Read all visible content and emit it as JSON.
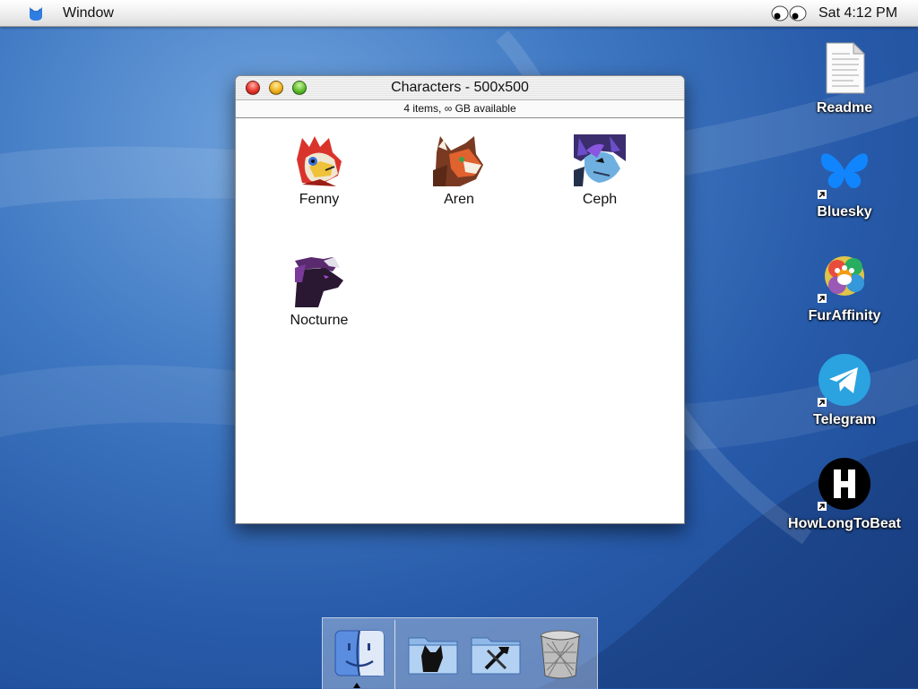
{
  "menubar": {
    "app_icon": "blue-cat-icon",
    "menu_items": [
      "Window"
    ],
    "extras_icon": "eyes-icon",
    "clock": "Sat 4:12 PM"
  },
  "window": {
    "title": "Characters - 500x500",
    "status": "4 items, ∞ GB available",
    "files": [
      {
        "name": "Fenny",
        "icon": "fenny-avatar-icon",
        "color": "#d9342b"
      },
      {
        "name": "Aren",
        "icon": "aren-avatar-icon",
        "color": "#e0622f"
      },
      {
        "name": "Ceph",
        "icon": "ceph-avatar-icon",
        "color": "#6a4fc9"
      },
      {
        "name": "Nocturne",
        "icon": "nocturne-avatar-icon",
        "color": "#2a1832"
      }
    ]
  },
  "desktop": {
    "icons": [
      {
        "label": "Readme",
        "icon": "document-icon"
      },
      {
        "label": "Bluesky",
        "icon": "butterfly-icon",
        "alias": true
      },
      {
        "label": "FurAffinity",
        "icon": "paw-icon",
        "alias": true
      },
      {
        "label": "Telegram",
        "icon": "paper-plane-icon",
        "alias": true
      },
      {
        "label": "HowLongToBeat",
        "icon": "hltb-icon",
        "alias": true
      }
    ]
  },
  "dock": {
    "items": [
      {
        "name": "Finder",
        "icon": "finder-icon",
        "running": true
      },
      {
        "name": "Folder",
        "icon": "fox-folder-icon"
      },
      {
        "name": "Folder",
        "icon": "tools-folder-icon"
      },
      {
        "name": "Trash",
        "icon": "trash-icon"
      }
    ]
  },
  "colors": {
    "desktop": "#2659a8",
    "close": "#e5352a",
    "minimize": "#f0b21c",
    "zoom": "#5fbf2e"
  }
}
